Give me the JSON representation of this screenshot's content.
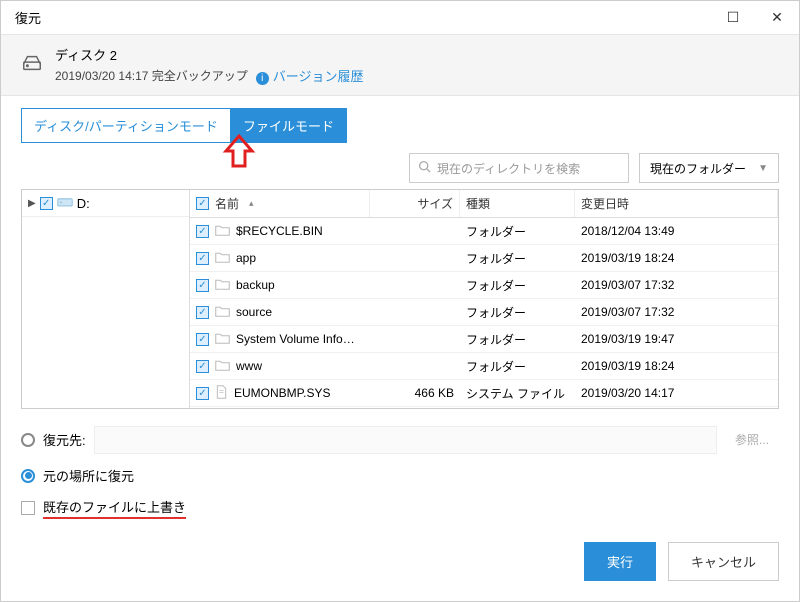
{
  "title": "復元",
  "banner": {
    "disk_label": "ディスク 2",
    "subtitle": "2019/03/20 14:17 完全バックアップ",
    "version_history": "バージョン履歴"
  },
  "modes": {
    "disk_partition": "ディスク/パーティションモード",
    "file": "ファイルモード"
  },
  "search": {
    "placeholder": "現在のディレクトリを検索",
    "folder_scope": "現在のフォルダー"
  },
  "tree": {
    "drive": "D:"
  },
  "table": {
    "headers": {
      "name": "名前",
      "size": "サイズ",
      "type": "種類",
      "date": "変更日時"
    },
    "rows": [
      {
        "name": "$RECYCLE.BIN",
        "size": "",
        "type": "フォルダー",
        "date": "2018/12/04 13:49",
        "icon": "folder"
      },
      {
        "name": "app",
        "size": "",
        "type": "フォルダー",
        "date": "2019/03/19 18:24",
        "icon": "folder"
      },
      {
        "name": "backup",
        "size": "",
        "type": "フォルダー",
        "date": "2019/03/07 17:32",
        "icon": "folder"
      },
      {
        "name": "source",
        "size": "",
        "type": "フォルダー",
        "date": "2019/03/07 17:32",
        "icon": "folder"
      },
      {
        "name": "System Volume Info…",
        "size": "",
        "type": "フォルダー",
        "date": "2019/03/19 19:47",
        "icon": "folder"
      },
      {
        "name": "www",
        "size": "",
        "type": "フォルダー",
        "date": "2019/03/19 18:24",
        "icon": "folder"
      },
      {
        "name": "EUMONBMP.SYS",
        "size": "466 KB",
        "type": "システム ファイル",
        "date": "2019/03/20 14:17",
        "icon": "file"
      }
    ]
  },
  "dest": {
    "restore_to": "復元先:",
    "browse": "参照...",
    "restore_original": "元の場所に復元",
    "overwrite": "既存のファイルに上書き"
  },
  "footer": {
    "run": "実行",
    "cancel": "キャンセル"
  }
}
